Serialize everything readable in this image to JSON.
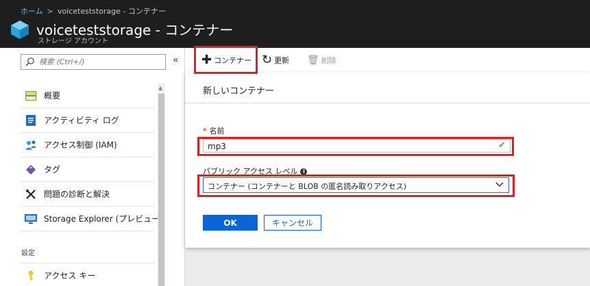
{
  "header": {
    "breadcrumb": [
      {
        "label": "ホーム"
      },
      {
        "label": "voiceteststorage - コンテナー"
      }
    ],
    "breadcrumb_separator": ">",
    "title": "voiceteststorage - コンテナー",
    "subtitle": "ストレージ アカウント",
    "icon": "storage-cube-icon"
  },
  "sidebar": {
    "search_placeholder": "検索 (Ctrl+/)",
    "collapse_label": "«",
    "items": [
      {
        "label": "概要",
        "icon": "overview-icon"
      },
      {
        "label": "アクティビティ ログ",
        "icon": "activity-log-icon"
      },
      {
        "label": "アクセス制御 (IAM)",
        "icon": "iam-icon"
      },
      {
        "label": "タグ",
        "icon": "tag-icon"
      },
      {
        "label": "問題の診断と解決",
        "icon": "wrench-icon"
      },
      {
        "label": "Storage Explorer (プレビュー)",
        "icon": "storage-explorer-icon"
      }
    ],
    "section_label": "設定",
    "section_items": [
      {
        "label": "アクセス キー",
        "icon": "key-icon"
      }
    ]
  },
  "toolbar": {
    "add_label": "コンテナー",
    "refresh_label": "更新",
    "delete_label": "削除"
  },
  "dialog": {
    "title": "新しいコンテナー",
    "name_label": "名前",
    "name_required_mark": "*",
    "name_value": "mp3",
    "access_label": "パブリック アクセス レベル",
    "access_value": "コンテナー (コンテナーと BLOB の匿名読み取りアクセス)",
    "ok_label": "OK",
    "cancel_label": "キャンセル"
  },
  "colors": {
    "header_bg": "#1e1e1e",
    "accent": "#0a66d4",
    "highlight": "#e3201b",
    "valid_check": "#4caf50"
  }
}
